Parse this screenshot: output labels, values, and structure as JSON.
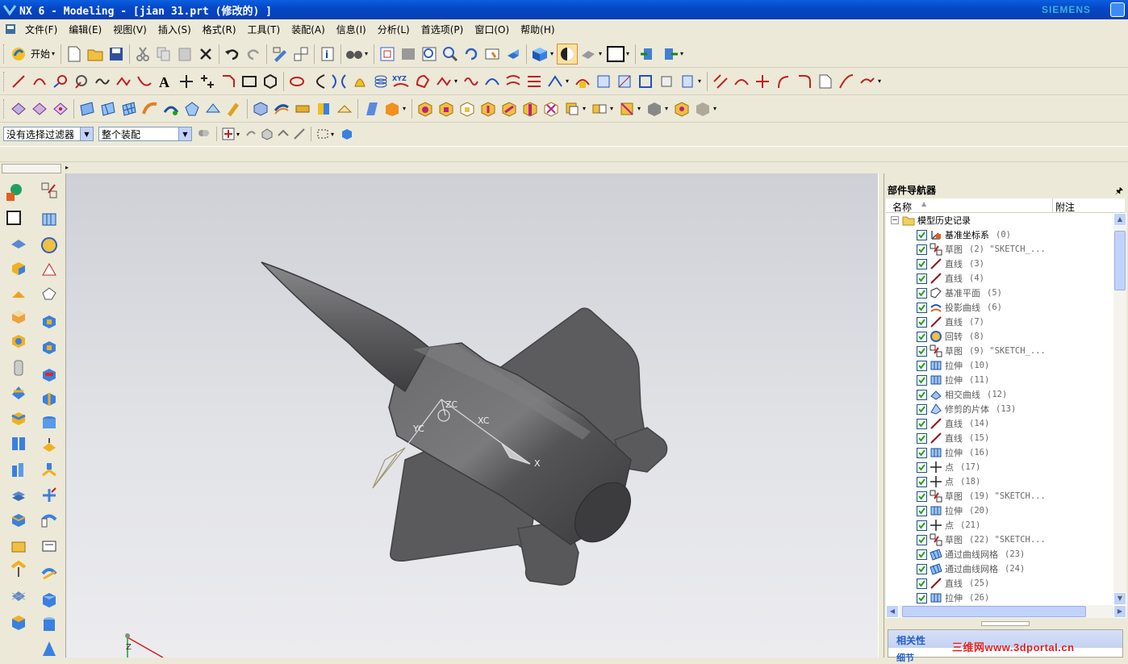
{
  "window": {
    "title": "NX 6 - Modeling - [jian 31.prt  (修改的) ]",
    "brand": "SIEMENS"
  },
  "menu": [
    "文件(F)",
    "编辑(E)",
    "视图(V)",
    "插入(S)",
    "格式(R)",
    "工具(T)",
    "装配(A)",
    "信息(I)",
    "分析(L)",
    "首选项(P)",
    "窗口(O)",
    "帮助(H)"
  ],
  "toolbar": {
    "start_label": "开始"
  },
  "filters": {
    "selection_filter": "没有选择过滤器",
    "scope": "整个装配"
  },
  "navigator": {
    "title": "部件导航器",
    "col_name": "名称",
    "col_note": "附注",
    "root": "模型历史记录",
    "items": [
      {
        "name": "基准坐标系",
        "num": "(0)",
        "icon": "datum-csys-icon",
        "dark": true
      },
      {
        "name": "草图",
        "num": "(2) \"SKETCH_...",
        "icon": "sketch-icon"
      },
      {
        "name": "直线",
        "num": "(3)",
        "icon": "line-icon"
      },
      {
        "name": "直线",
        "num": "(4)",
        "icon": "line-icon"
      },
      {
        "name": "基准平面",
        "num": "(5)",
        "icon": "datum-plane-icon"
      },
      {
        "name": "投影曲线",
        "num": "(6)",
        "icon": "projected-curve-icon"
      },
      {
        "name": "直线",
        "num": "(7)",
        "icon": "line-icon"
      },
      {
        "name": "回转",
        "num": "(8)",
        "icon": "revolve-icon"
      },
      {
        "name": "草图",
        "num": "(9) \"SKETCH_...",
        "icon": "sketch-icon"
      },
      {
        "name": "拉伸",
        "num": "(10)",
        "icon": "extrude-icon"
      },
      {
        "name": "拉伸",
        "num": "(11)",
        "icon": "extrude-icon"
      },
      {
        "name": "相交曲线",
        "num": "(12)",
        "icon": "intersection-curve-icon"
      },
      {
        "name": "修剪的片体",
        "num": "(13)",
        "icon": "trimmed-sheet-icon"
      },
      {
        "name": "直线",
        "num": "(14)",
        "icon": "line-icon"
      },
      {
        "name": "直线",
        "num": "(15)",
        "icon": "line-icon"
      },
      {
        "name": "拉伸",
        "num": "(16)",
        "icon": "extrude-icon"
      },
      {
        "name": "点",
        "num": "(17)",
        "icon": "point-icon"
      },
      {
        "name": "点",
        "num": "(18)",
        "icon": "point-icon"
      },
      {
        "name": "草图",
        "num": "(19) \"SKETCH...",
        "icon": "sketch-icon"
      },
      {
        "name": "拉伸",
        "num": "(20)",
        "icon": "extrude-icon"
      },
      {
        "name": "点",
        "num": "(21)",
        "icon": "point-icon"
      },
      {
        "name": "草图",
        "num": "(22) \"SKETCH...",
        "icon": "sketch-icon"
      },
      {
        "name": "通过曲线网格",
        "num": "(23)",
        "icon": "through-curve-mesh-icon"
      },
      {
        "name": "通过曲线网格",
        "num": "(24)",
        "icon": "through-curve-mesh-icon"
      },
      {
        "name": "直线",
        "num": "(25)",
        "icon": "line-icon"
      },
      {
        "name": "拉伸",
        "num": "(26)",
        "icon": "extrude-icon"
      }
    ],
    "rel_title": "相关性",
    "rel_sub": "细节"
  },
  "viewport": {
    "csys_labels": {
      "zc": "ZC",
      "yc": "YC",
      "xc": "XC",
      "x": "X",
      "z": "Z"
    }
  },
  "watermark": "三维网www.3dportal.cn",
  "colors": {
    "title_blue": "#0a5fe0",
    "check_green": "#21a121",
    "model_gray": "#5a5a5c"
  }
}
